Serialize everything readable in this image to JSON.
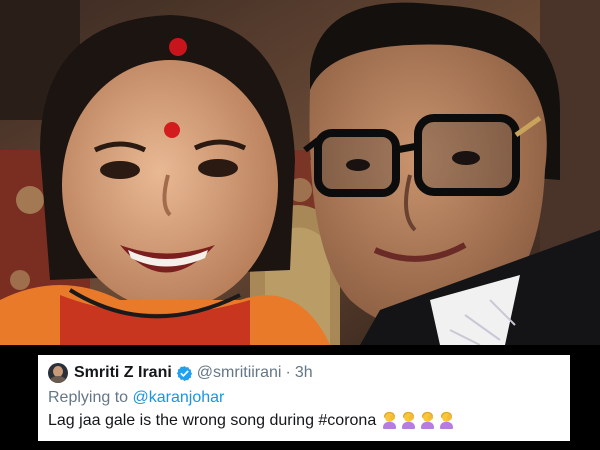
{
  "tweet": {
    "display_name": "Smriti Z Irani",
    "handle": "@smritiirani",
    "separator": "·",
    "time": "3h",
    "replying_prefix": "Replying to",
    "replying_to": "@karanjohar",
    "text": "Lag jaa gale is the wrong song during #corona",
    "emoji": [
      "woman-facepalming-icon",
      "woman-facepalming-icon",
      "woman-facepalming-icon",
      "woman-facepalming-icon"
    ]
  },
  "colors": {
    "primary_text": "#14171a",
    "secondary_text": "#657786",
    "link": "#1b95e0",
    "verified": "#1da1f2",
    "background": "#000000"
  }
}
